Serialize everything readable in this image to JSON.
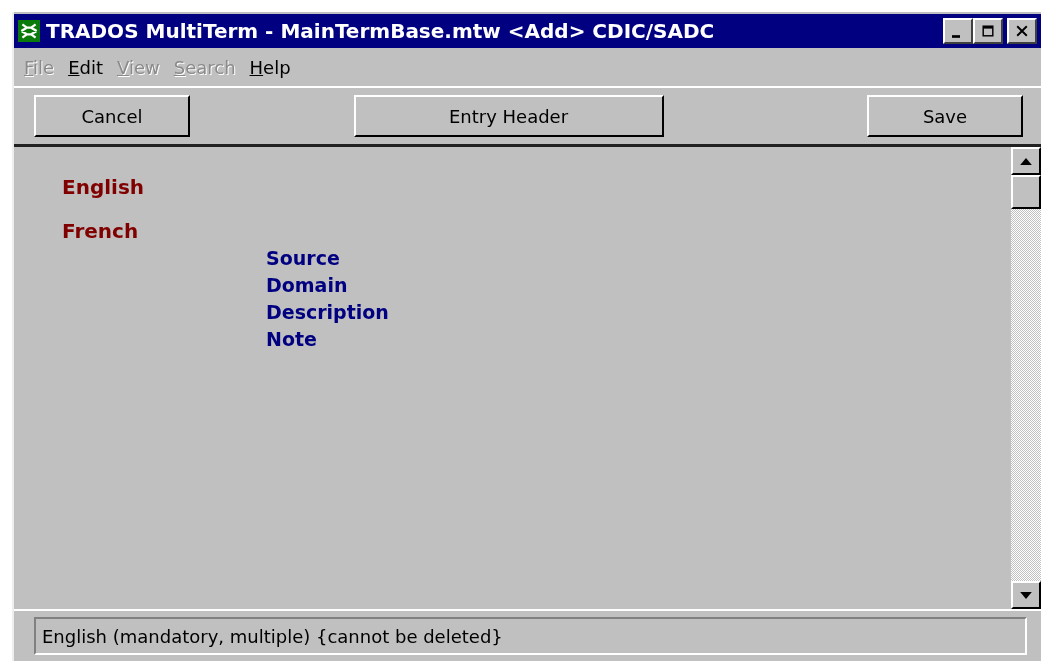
{
  "window": {
    "title": "TRADOS MultiTerm - MainTermBase.mtw <Add> CDIC/SADC"
  },
  "menu": [
    {
      "label": "File",
      "disabled": true
    },
    {
      "label": "Edit",
      "disabled": false
    },
    {
      "label": "View",
      "disabled": true
    },
    {
      "label": "Search",
      "disabled": true
    },
    {
      "label": "Help",
      "disabled": false
    }
  ],
  "toolbar": [
    "Cancel",
    "Entry Header",
    "Save"
  ],
  "languages": [
    {
      "name": "English"
    },
    {
      "name": "French",
      "fields": [
        "Source",
        "Domain",
        "Description",
        "Note"
      ]
    }
  ],
  "status_bar": "English (mandatory, multiple) {cannot be deleted}"
}
